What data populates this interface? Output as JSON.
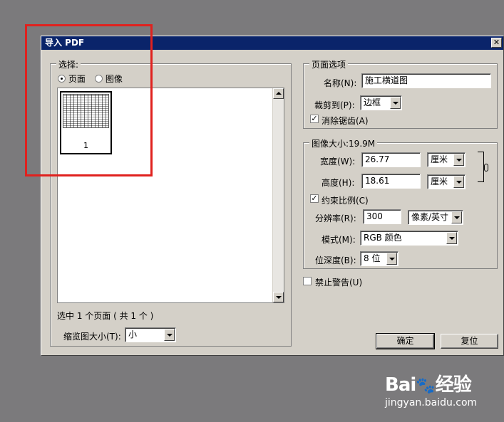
{
  "dialog": {
    "title": "导入 PDF",
    "close_glyph": "✕"
  },
  "selection": {
    "group_label": "选择:",
    "radio_page_label": "页面",
    "radio_image_label": "图像",
    "thumbnail_page_number": "1",
    "status_text": "选中 1 个页面 ( 共 1 个 )",
    "thumb_size_label": "缩览图大小(T):",
    "thumb_size_value": "小"
  },
  "page_options": {
    "group_label": "页面选项",
    "name_label": "名称(N):",
    "name_value": "施工横道图",
    "crop_label": "裁剪到(P):",
    "crop_value": "边框",
    "antialias_label": "消除锯齿(A)",
    "antialias_checked": "✓"
  },
  "image_size": {
    "group_label": "图像大小:19.9M",
    "width_label": "宽度(W):",
    "width_value": "26.77",
    "width_unit": "厘米",
    "height_label": "高度(H):",
    "height_value": "18.61",
    "height_unit": "厘米",
    "constrain_label": "约束比例(C)",
    "constrain_checked": "✓",
    "resolution_label": "分辨率(R):",
    "resolution_value": "300",
    "resolution_unit": "像素/英寸",
    "mode_label": "模式(M):",
    "mode_value": "RGB 颜色",
    "depth_label": "位深度(B):",
    "depth_value": "8 位"
  },
  "suppress_warnings_label": "禁止警告(U)",
  "buttons": {
    "ok": "确定",
    "reset": "复位"
  },
  "watermark": {
    "logo_text": "Bai",
    "logo_suffix": "经验",
    "site": "jingyan.baidu.com"
  },
  "colors": {
    "titlebar": "#0a246a",
    "dialog_face": "#d4d0c8",
    "highlight": "#e0211e",
    "desktop": "#7b7a7c"
  }
}
